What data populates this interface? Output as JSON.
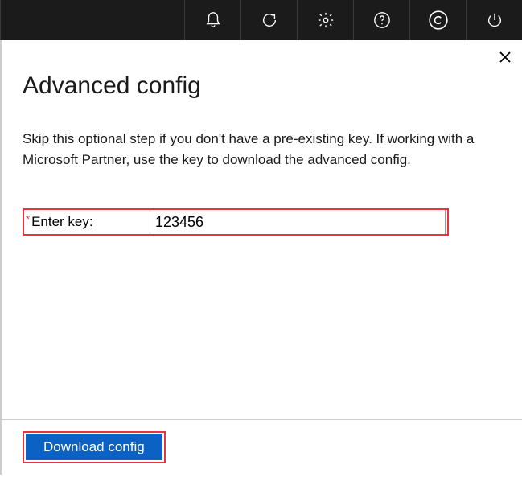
{
  "topbar": {
    "icons": [
      "bell-icon",
      "refresh-icon",
      "gear-icon",
      "help-icon",
      "copyright-icon",
      "power-icon"
    ]
  },
  "panel": {
    "title": "Advanced config",
    "description": "Skip this optional step if you don't have a pre-existing key. If working with a Microsoft Partner, use the key to download the advanced config.",
    "required_marker": "*",
    "field_label": "Enter key:",
    "field_value": "123456"
  },
  "footer": {
    "download_label": "Download config"
  }
}
